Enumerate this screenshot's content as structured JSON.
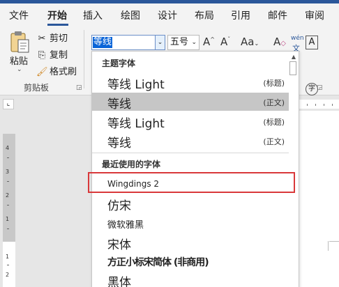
{
  "tabs": [
    "文件",
    "开始",
    "插入",
    "绘图",
    "设计",
    "布局",
    "引用",
    "邮件",
    "审阅"
  ],
  "active_tab": "开始",
  "clipboard": {
    "paste_label": "粘贴",
    "cut_label": "剪切",
    "copy_label": "复制",
    "format_painter_label": "格式刷",
    "group_label": "剪贴板"
  },
  "font": {
    "current_font": "等线",
    "current_size": "五号",
    "grow_icon": "A^",
    "shrink_icon": "Aˇ",
    "case_icon": "Aa",
    "clear_icon": "A",
    "phonetic_top": "wén",
    "phonetic_bottom": "文",
    "box_icon": "A",
    "enclose_icon": "字"
  },
  "dropdown": {
    "theme_header": "主题字体",
    "theme_fonts": [
      {
        "name": "等线 Light",
        "tag": "(标题)"
      },
      {
        "name": "等线",
        "tag": "(正文)"
      },
      {
        "name": "等线 Light",
        "tag": "(标题)"
      },
      {
        "name": "等线",
        "tag": "(正文)"
      }
    ],
    "recent_header": "最近使用的字体",
    "recent_fonts": [
      "Wingdings 2",
      "仿宋",
      "微软雅黑",
      "宋体",
      "方正小标宋简体 (非商用)",
      "黑体"
    ]
  },
  "ruler": {
    "vertical_numbers": [
      "4",
      "3",
      "2",
      "1",
      "1",
      "2",
      "1"
    ]
  },
  "colors": {
    "accent": "#2b579a",
    "highlight_border": "#d9383a",
    "selection": "#0a64d8"
  }
}
